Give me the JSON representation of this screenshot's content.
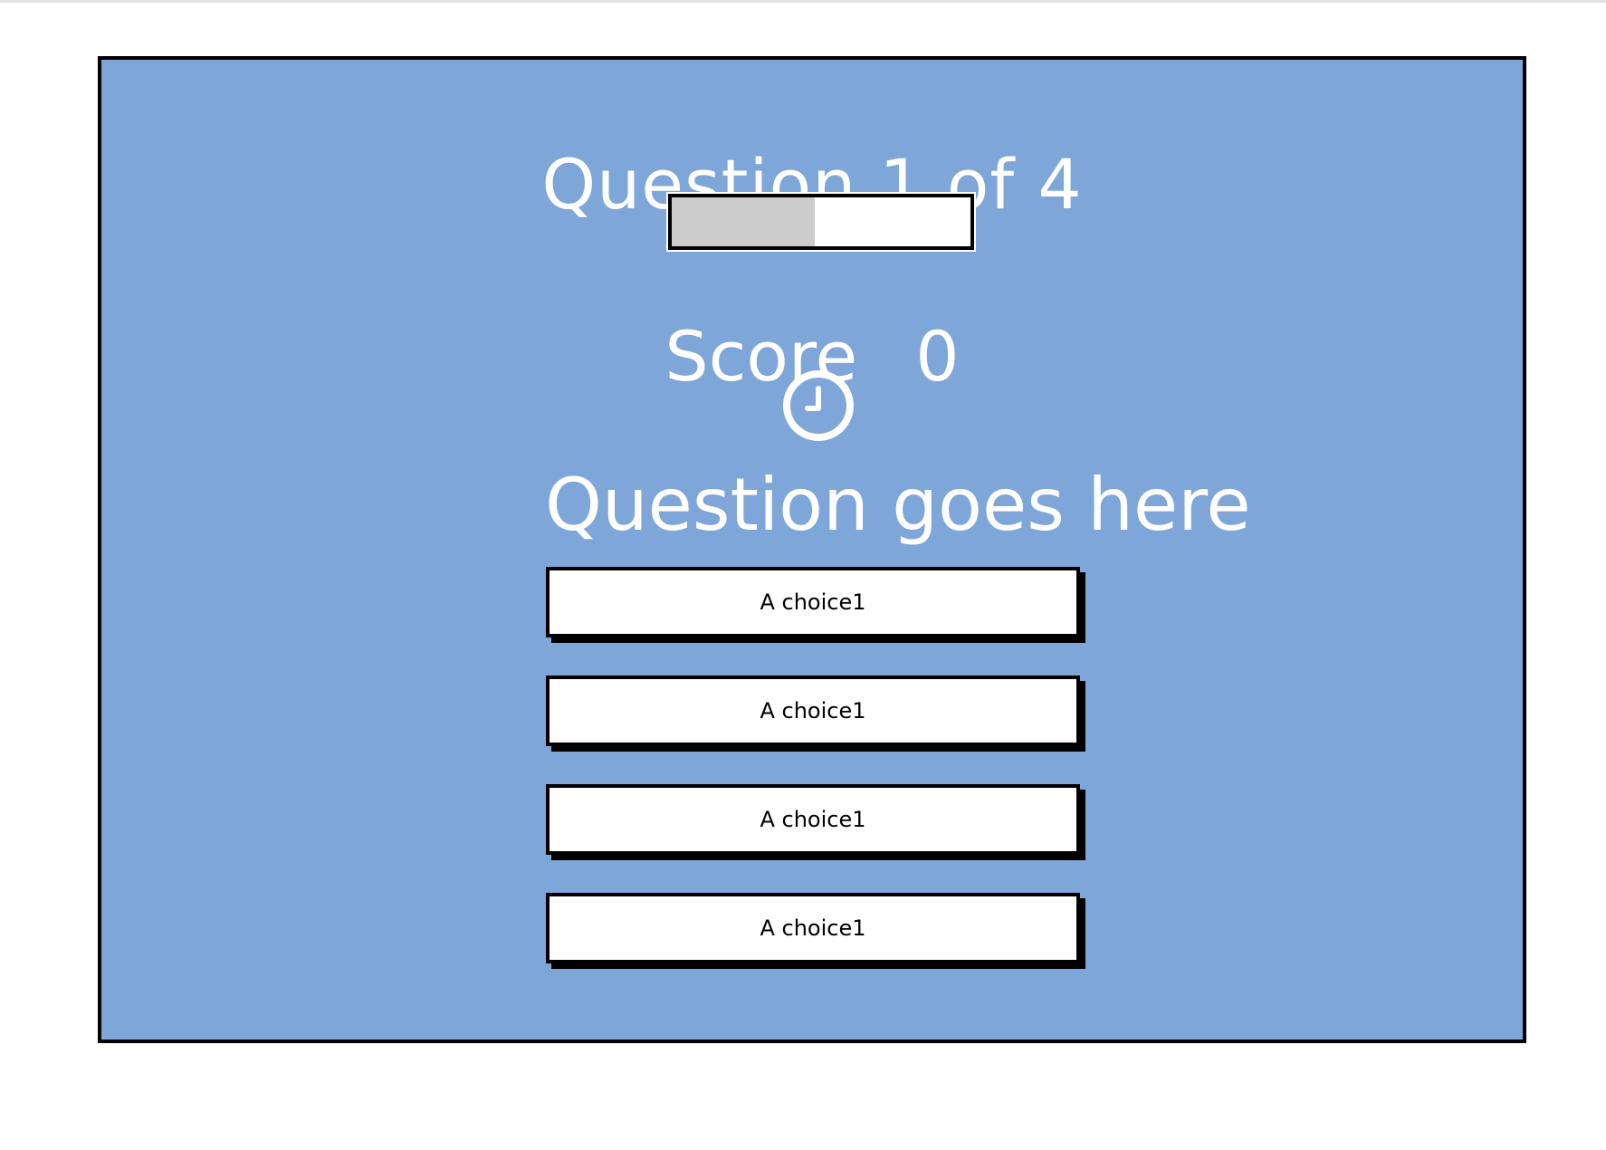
{
  "quiz": {
    "question_counter": "Question 1 of 4",
    "progress": 0.48,
    "score_label": "Score",
    "score_value": "0",
    "timer_icon": "clock-icon",
    "question_text": "Question goes here",
    "choices": [
      {
        "label": "A choice1"
      },
      {
        "label": "A choice1"
      },
      {
        "label": "A choice1"
      },
      {
        "label": "A choice1"
      }
    ]
  },
  "colors": {
    "panel_background": "#7ea6d8",
    "progress_fill": "#cccccc",
    "text_primary": "#ffffff",
    "border": "#000000"
  }
}
